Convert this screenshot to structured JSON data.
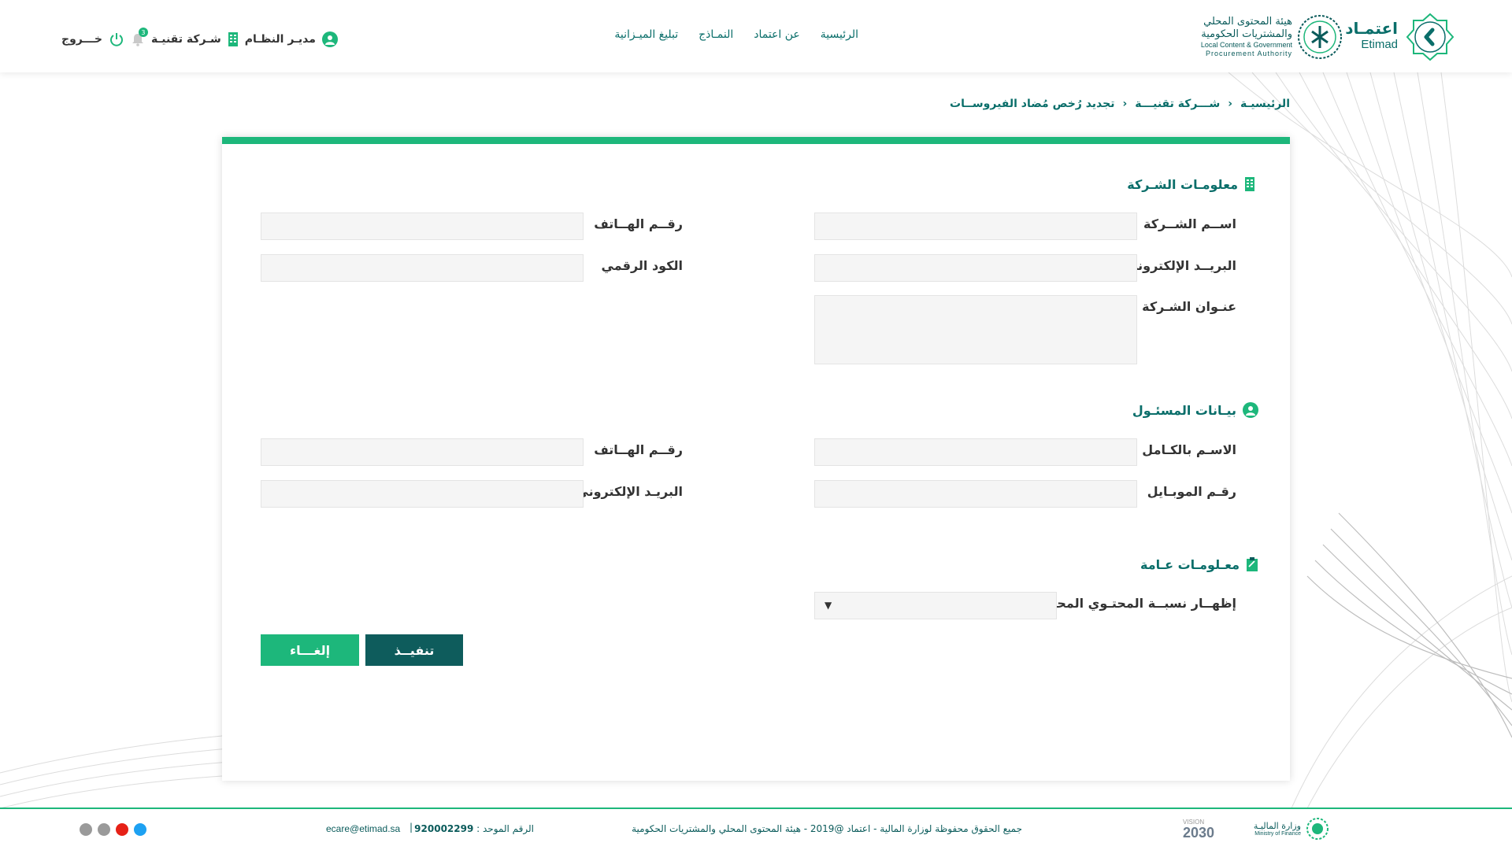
{
  "brand": {
    "etimad_ar": "اعتمـاد",
    "etimad_en": "Etimad",
    "lcgpa_line1": "هيئة المحتوى المحلي",
    "lcgpa_line2": "والمشتريات الحكومية",
    "lcgpa_line3": "Local Content & Government",
    "lcgpa_line4": "Procurement Authority"
  },
  "nav": {
    "home": "الرئيسية",
    "about": "عن اعتماد",
    "forms": "النمـاذج",
    "budget": "تبليغ الميـزانية"
  },
  "user": {
    "role": "مديـر النظـام",
    "company": "شـركة تقنيـة",
    "notifications": "3",
    "logout": "خـــروج"
  },
  "breadcrumb": {
    "home": "الرئيسيـة",
    "company": "شـــركة تقنيـــة",
    "current": "تجديد رُخص مُضاد الفيروســات"
  },
  "sections": {
    "company_info": "معلومـات الشـركة",
    "responsible": "بيـانات المسئـول",
    "general": "معـلومـات عـامة"
  },
  "company_form": {
    "name_label": "اســم الشــركة",
    "name_value": "",
    "phone_label": "رقــم الهــاتف",
    "phone_value": "",
    "email_label": "البريــد الإلكتروني",
    "email_value": "",
    "code_label": "الكود الرقمي",
    "code_value": "",
    "address_label": "عنـوان الشـركة",
    "address_value": ""
  },
  "responsible_form": {
    "fullname_label": "الاسـم بالكـامل",
    "fullname_value": "",
    "phone_label": "رقــم الهــاتف",
    "phone_value": "",
    "mobile_label": "رقـم الموبـايل",
    "mobile_value": "",
    "email_label": "البريـد الإلكتروني",
    "email_value": ""
  },
  "general_form": {
    "local_content_label": "إظهــار نسبــة المحتـوي المحلي",
    "local_content_value": ""
  },
  "buttons": {
    "execute": "تنفيــذ",
    "cancel": "إلغـــاء"
  },
  "footer": {
    "copyright": "جميع الحقوق محفوظة لوزارة المالية - اعتماد @2019 - هيئة المحتوى المحلي والمشتريات الحكومية",
    "phone_label": "الرقم الموحد : ",
    "phone_value": "920002299",
    "email": "ecare@etimad.sa",
    "mof_ar": "وزارة الماليـة",
    "mof_en": "Ministry of Finance",
    "vision_label": "VISION",
    "vision_year": "2030"
  },
  "colors": {
    "primary_green": "#1db77b",
    "dark_teal": "#0e5c5c",
    "text_teal": "#0a6e6a",
    "twitter": "#1da1f2",
    "youtube": "#e62117",
    "social_gray": "#9a9a9a"
  },
  "icons": {
    "user": "user-icon",
    "building": "building-icon",
    "bell": "bell-icon",
    "power": "power-icon",
    "clipboard": "clipboard-icon",
    "chevron": "chevron-left-icon",
    "dropdown": "caret-down-icon"
  }
}
